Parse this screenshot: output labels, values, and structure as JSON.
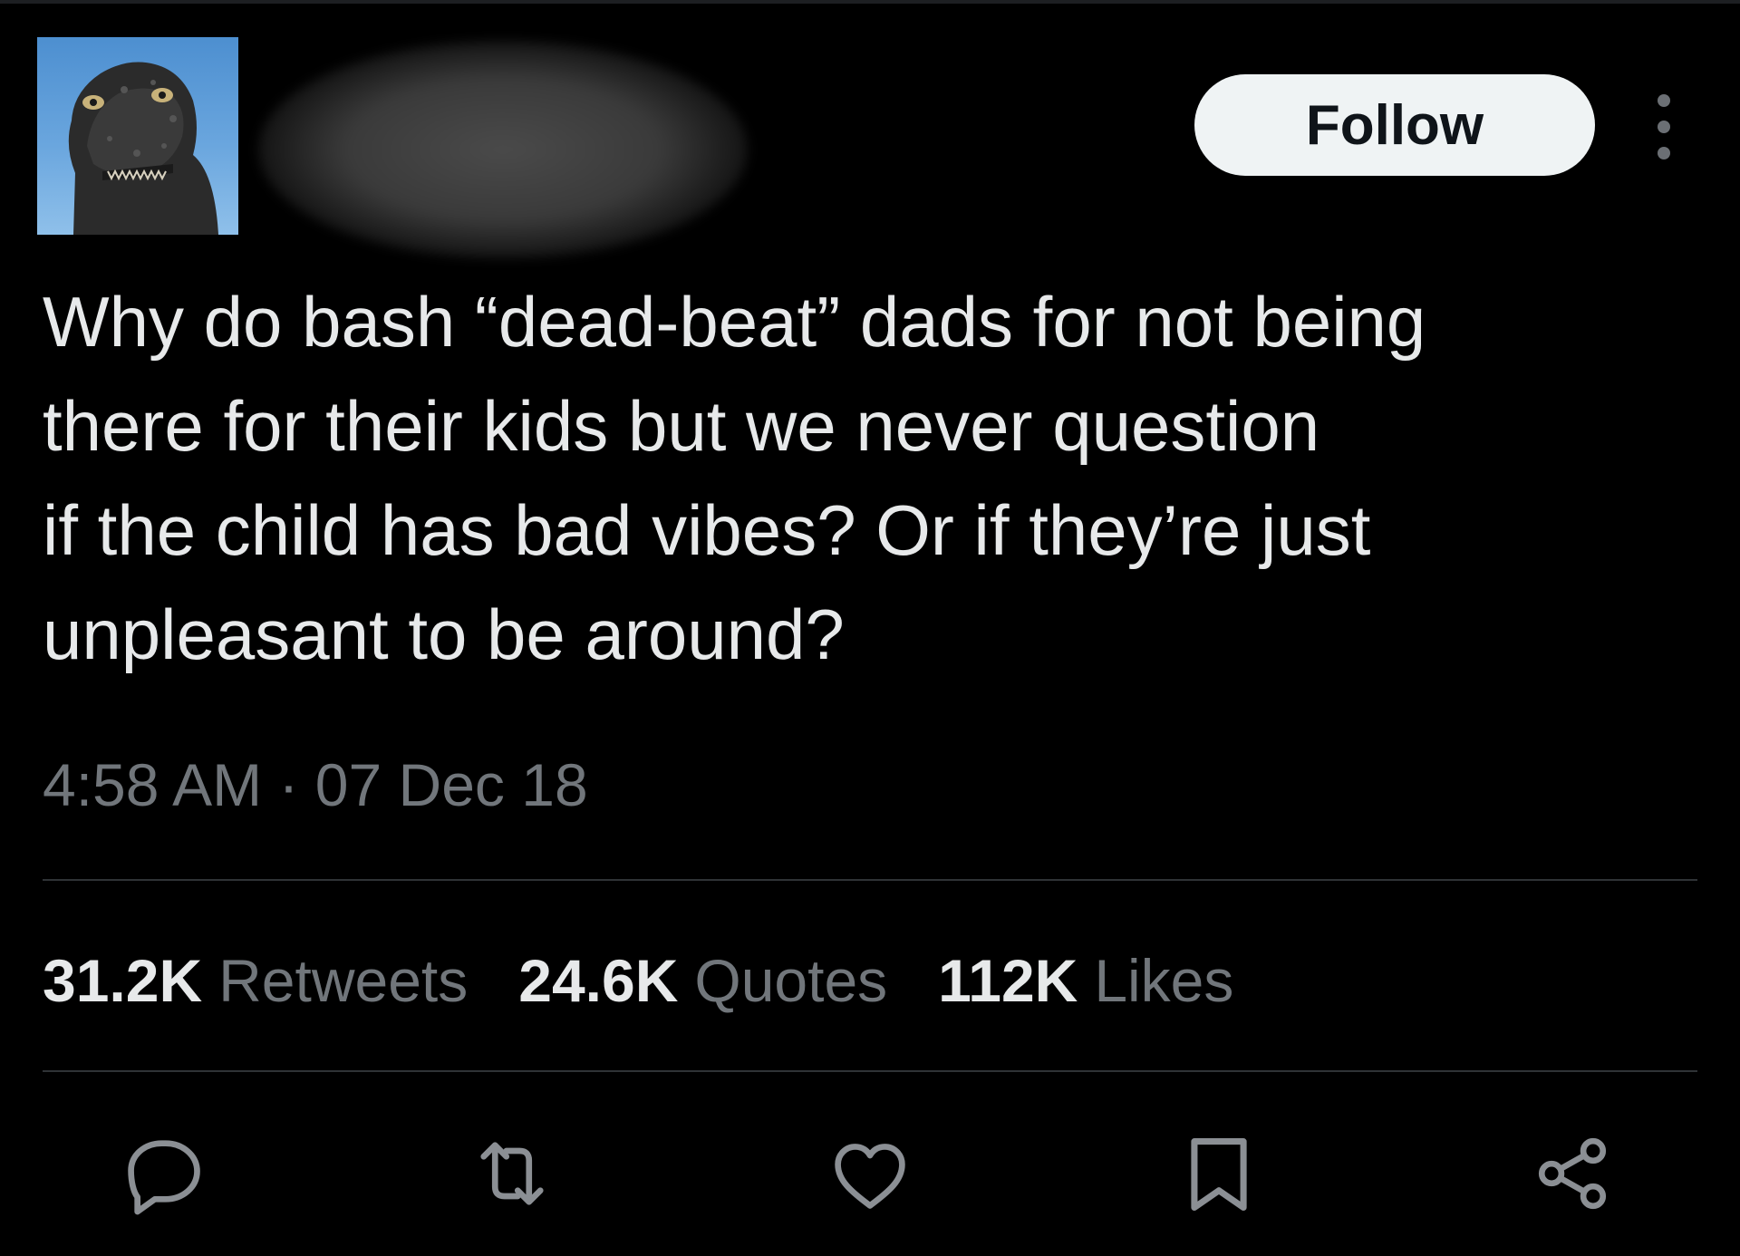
{
  "tweet": {
    "follow_label": "Follow",
    "text": "Why do bash “dead-beat” dads for not being\nthere for their kids but we never question\nif the child has bad vibes? Or if they’re just\nunpleasant to be around?",
    "timestamp": "4:58 AM · 07 Dec 18"
  },
  "stats": {
    "retweets": {
      "count": "31.2K",
      "label": "Retweets"
    },
    "quotes": {
      "count": "24.6K",
      "label": "Quotes"
    },
    "likes": {
      "count": "112K",
      "label": "Likes"
    }
  },
  "icons": {
    "avatar": "godzilla-avatar",
    "more": "more-icon",
    "reply": "reply-icon",
    "retweet": "retweet-icon",
    "like": "heart-icon",
    "bookmark": "bookmark-icon",
    "share": "share-icon"
  },
  "colors": {
    "background": "#000000",
    "text_primary": "#e7e9ea",
    "text_secondary": "#71767b",
    "divider": "#2f3336",
    "follow_button_bg": "#eff3f4",
    "follow_button_text": "#0f1419",
    "icon": "#8b8f94"
  }
}
